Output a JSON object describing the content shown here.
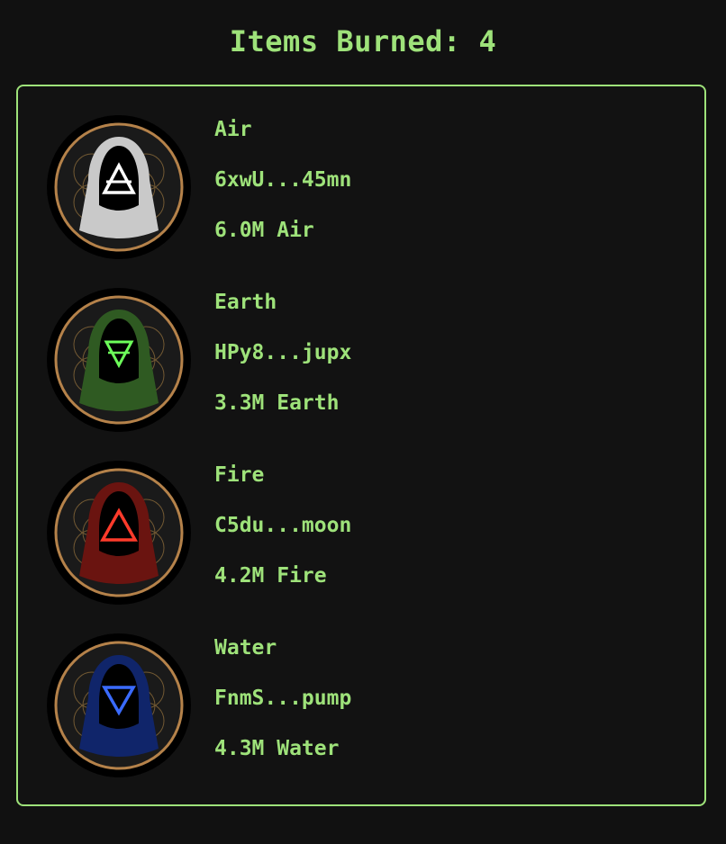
{
  "header": {
    "title": "Items Burned: 4"
  },
  "items": [
    {
      "name": "Air",
      "address": "6xwU...45mn",
      "amount": "6.0M Air",
      "color": "#c9c9c9",
      "symbol_color": "#ffffff",
      "symbol": "air-symbol"
    },
    {
      "name": "Earth",
      "address": "HPy8...jupx",
      "amount": "3.3M Earth",
      "color": "#2f5a22",
      "symbol_color": "#6dff5a",
      "symbol": "earth-symbol"
    },
    {
      "name": "Fire",
      "address": "C5du...moon",
      "amount": "4.2M Fire",
      "color": "#6a1410",
      "symbol_color": "#ff3b2b",
      "symbol": "fire-symbol"
    },
    {
      "name": "Water",
      "address": "FnmS...pump",
      "amount": "4.3M Water",
      "color": "#10256a",
      "symbol_color": "#3a6bff",
      "symbol": "water-symbol"
    }
  ],
  "colors": {
    "background": "#111111",
    "accent": "#9ee27a",
    "ring_gold": "#b5824a"
  }
}
